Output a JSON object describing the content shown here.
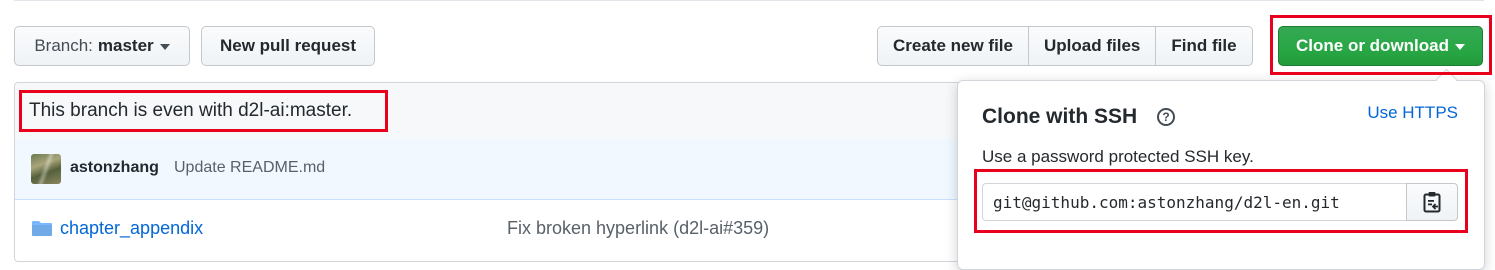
{
  "toolbar": {
    "branch_prefix": "Branch:",
    "branch_name": "master",
    "new_pull_request": "New pull request",
    "create_new_file": "Create new file",
    "upload_files": "Upload files",
    "find_file": "Find file",
    "clone_or_download": "Clone or download"
  },
  "compare": {
    "status_text": "This branch is even with d2l-ai:master."
  },
  "latest_commit": {
    "author": "astonzhang",
    "message": "Update README.md"
  },
  "files": [
    {
      "name": "chapter_appendix",
      "type": "folder",
      "commit": "Fix broken hyperlink (d2l-ai#359)"
    }
  ],
  "clone_panel": {
    "title": "Clone with SSH",
    "toggle_link": "Use HTTPS",
    "description": "Use a password protected SSH key.",
    "url": "git@github.com:astonzhang/d2l-en.git"
  },
  "colors": {
    "accent_green": "#28a745",
    "link_blue": "#0366d6",
    "highlight_red": "#e8001c"
  },
  "icons": [
    "caret-down-icon",
    "folder-icon",
    "question-icon",
    "clipboard-icon"
  ]
}
